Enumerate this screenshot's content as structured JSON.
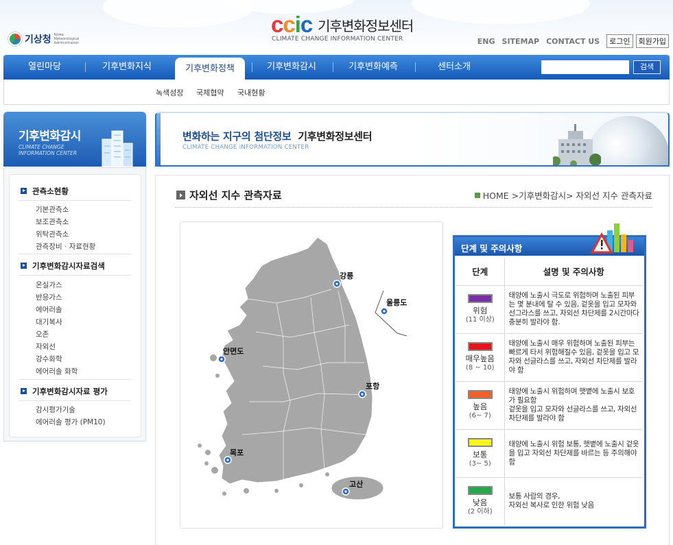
{
  "header": {
    "kma_logo_text": "기상청",
    "kma_logo_sub": "Korea Meteorological Administration",
    "ccic_mark": "CCIC",
    "ccic_title": "기후변화정보센터",
    "ccic_subtitle": "CLIMATE CHANGE INFORMATION CENTER",
    "util_links": [
      "ENG",
      "SITEMAP",
      "CONTACT US"
    ],
    "login_label": "로그인",
    "join_label": "회원가입"
  },
  "nav": {
    "items": [
      "열린마당",
      "기후변화지식",
      "기후변화정책",
      "기후변화감시",
      "기후변화예측",
      "센터소개"
    ],
    "active_index": 2,
    "search_placeholder": "",
    "search_button": "검색",
    "sub_items": [
      "녹색성장",
      "국제협약",
      "국내현황"
    ]
  },
  "sidebar": {
    "banner_title": "기후변화감시",
    "banner_sub": "CLIMATE CHANGE INFORMATION CENTER",
    "sections": [
      {
        "title": "관측소현황",
        "items": [
          "기본관측소",
          "보조관측소",
          "위탁관측소",
          "관측장비 · 자료현황"
        ]
      },
      {
        "title": "기후변화감시자료검색",
        "items": [
          "온실가스",
          "반응가스",
          "에어러솔",
          "대기복사",
          "오존",
          "자외선",
          "강수화학",
          "에어러솔 화학"
        ]
      },
      {
        "title": "기후변화감시자료 평가",
        "items": [
          "감시평가기술",
          "에어러솔 평가 (PM10)"
        ]
      }
    ]
  },
  "banner": {
    "title_blue": "변화하는 지구의 첨단정보",
    "title_dark": "기후변화정보센터",
    "subtitle": "CLIMATE CHANGE INFORMATION CENTER"
  },
  "content": {
    "page_title": "자외선 지수 관측자료",
    "breadcrumb": "HOME >기후변화감시> 자외선 지수 관측자료",
    "stations": [
      "강릉",
      "울릉도",
      "안면도",
      "포항",
      "목포",
      "고산"
    ],
    "legend": {
      "title": "단계 및 주의사항",
      "col_level": "단계",
      "col_desc": "설명 및 주의사항",
      "rows": [
        {
          "name": "위험",
          "range": "(11 이상)",
          "color": "#7a2fa6",
          "desc": "태양에 노출시 극도로 위험하며 노출된 피부는 몇 분내에 탈 수 있음, 겉옷을 입고 모자와 선그라스를 쓰고, 자외선 차단제를 2시간마다 충분히 발라야 함."
        },
        {
          "name": "매우높음",
          "range": "(8 ~ 10)",
          "color": "#e8141b",
          "desc": "태양에 노출시 매우 위험하며 노출된 피부는 빠르게 타서 위험해질수 있음, 겉옷을 입고 모자와 선글라스를 쓰고, 자외선 차단제를 발라야 함"
        },
        {
          "name": "높음",
          "range": "(6~ 7)",
          "color": "#f4602a",
          "desc": "태양에 노출시 위험하며 햇볕에 노출시 보호가 필요함\n겉옷을 입고 모자와 선글라스를 쓰고, 자외선 차단제를 발라야 함"
        },
        {
          "name": "보통",
          "range": "(3~ 5)",
          "color": "#f8f51c",
          "desc": "태양에 노출시 위험 보통, 햇볕에 노출시 겉옷을 입고 자외선 차단제를 바르는 등 주의해야 함"
        },
        {
          "name": "낮음",
          "range": "(2 이하)",
          "color": "#23a84a",
          "desc": "보통 사람의 경우,\n자외선 복사로 인한 위험 낮음"
        }
      ]
    }
  }
}
